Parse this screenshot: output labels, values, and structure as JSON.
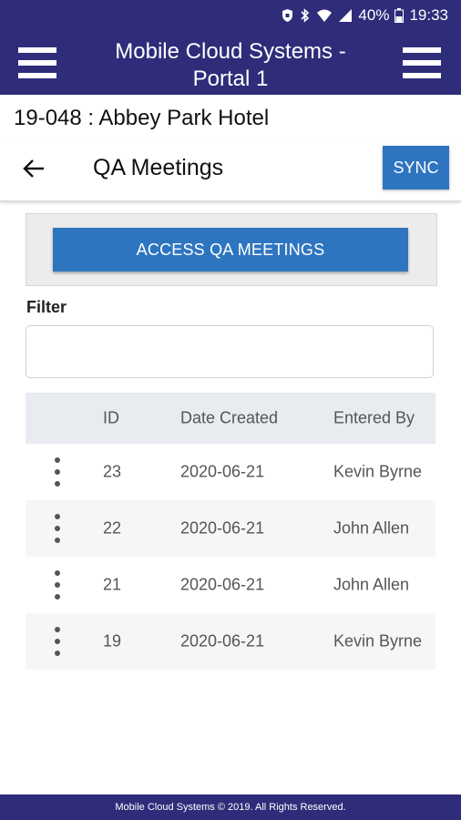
{
  "status_bar": {
    "battery": "40%",
    "time": "19:33",
    "icons": [
      "shield-icon",
      "bluetooth-icon",
      "wifi-icon",
      "signal-icon",
      "battery-icon"
    ]
  },
  "app_header": {
    "title_line1": "Mobile Cloud Systems -",
    "title_line2": "Portal 1",
    "left_icon": "hamburger-menu-icon",
    "right_icon": "hamburger-menu-icon"
  },
  "project": {
    "label": "19-048 : Abbey Park Hotel"
  },
  "page": {
    "title": "QA Meetings",
    "back_icon": "arrow-left-icon",
    "sync_label": "SYNC"
  },
  "access": {
    "button_label": "ACCESS QA MEETINGS"
  },
  "filter": {
    "label": "Filter",
    "value": "",
    "placeholder": ""
  },
  "table": {
    "columns": [
      "",
      "ID",
      "Date Created",
      "Entered By"
    ],
    "rows": [
      {
        "id": "23",
        "date": "2020-06-21",
        "by": "Kevin Byrne"
      },
      {
        "id": "22",
        "date": "2020-06-21",
        "by": "John Allen"
      },
      {
        "id": "21",
        "date": "2020-06-21",
        "by": "John Allen"
      },
      {
        "id": "19",
        "date": "2020-06-21",
        "by": "Kevin Byrne"
      }
    ]
  },
  "footer": {
    "text": "Mobile Cloud Systems © 2019. All Rights Reserved."
  },
  "colors": {
    "brand": "#2f2d7a",
    "button": "#2e75c0",
    "table_header": "#e8ebf0"
  }
}
